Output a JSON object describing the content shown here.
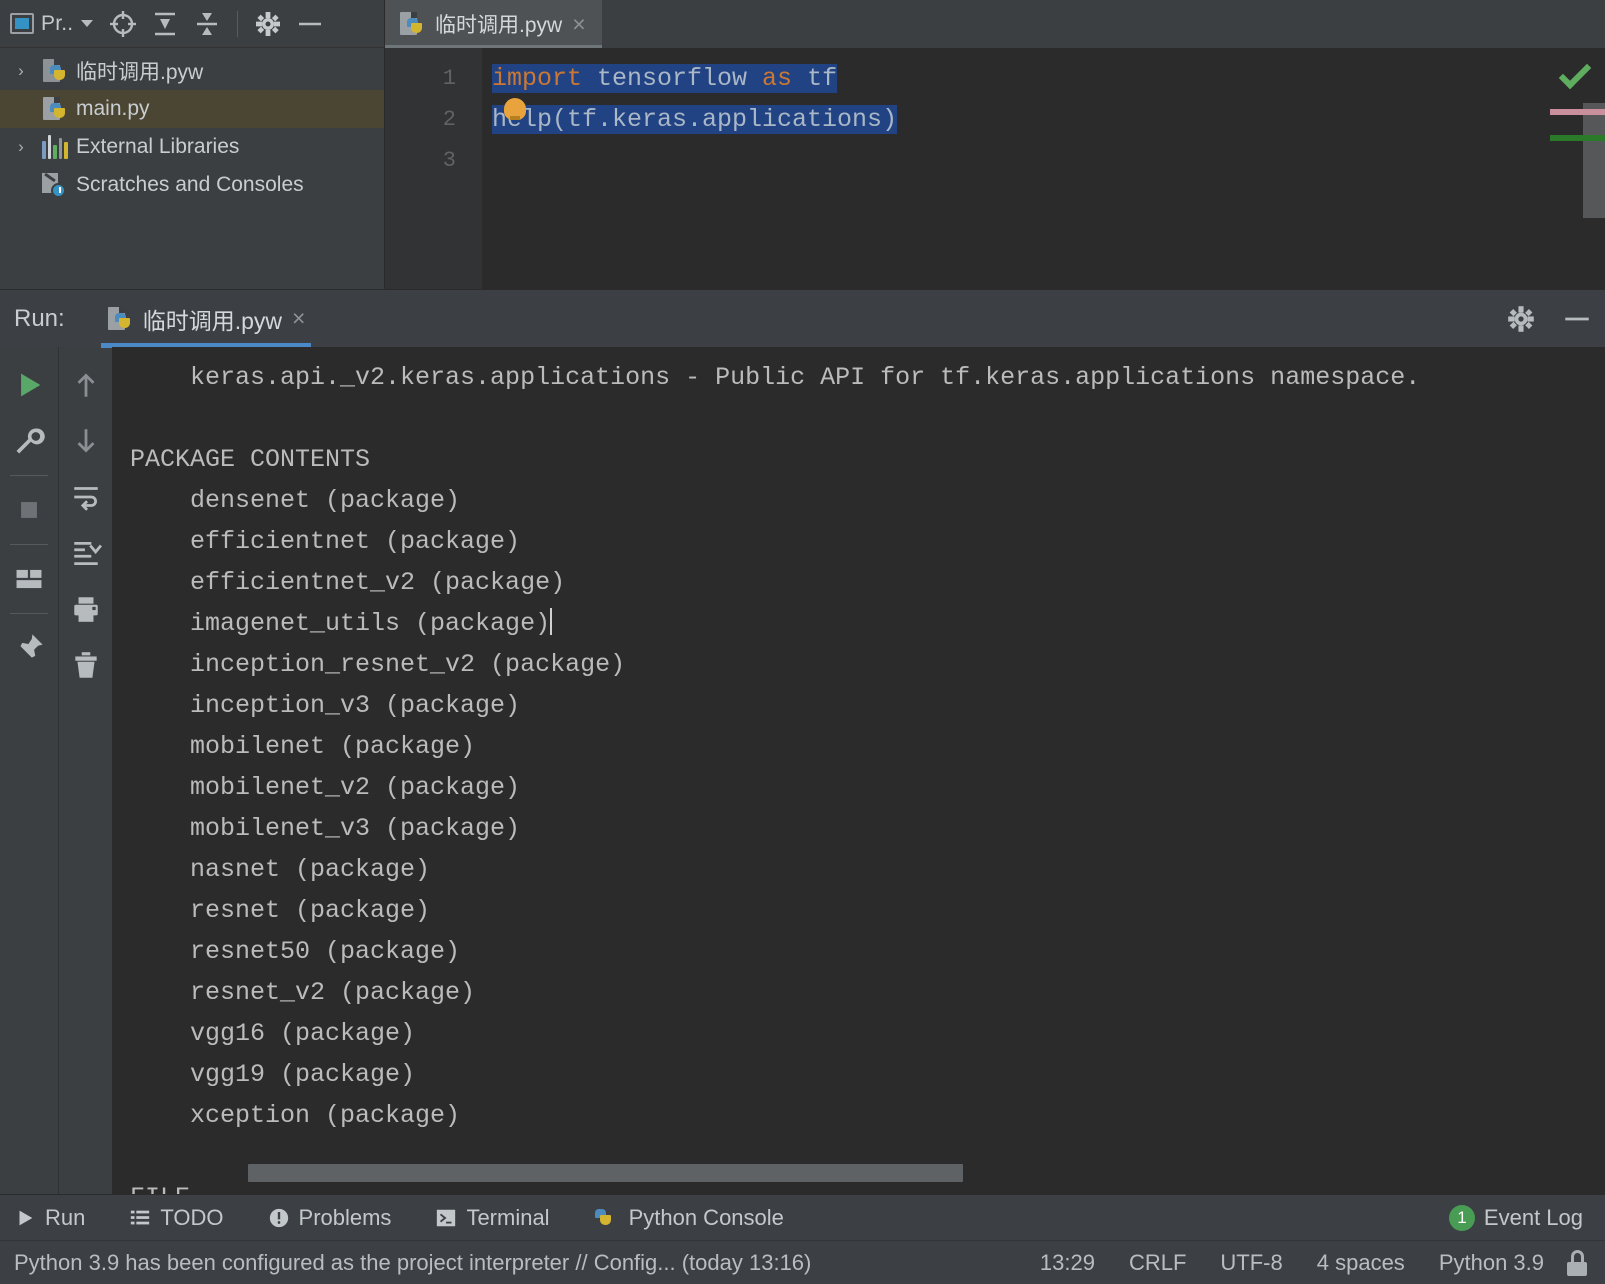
{
  "project_panel": {
    "title": "Pr..",
    "title_icon": "project-window-icon",
    "header_icons": [
      "locate-icon",
      "expand-all-icon",
      "collapse-all-icon",
      "gear-icon",
      "minimize-icon"
    ],
    "tree": [
      {
        "arrow": "›",
        "icon": "python-folder-icon",
        "label": "临时调用.pyw",
        "selected": false
      },
      {
        "arrow": "",
        "icon": "python-file-icon",
        "label": "main.py",
        "selected": true
      },
      {
        "arrow": "›",
        "icon": "external-libraries-icon",
        "label": "External Libraries",
        "selected": false
      },
      {
        "arrow": "",
        "icon": "scratches-icon",
        "label": "Scratches and Consoles",
        "selected": false
      }
    ]
  },
  "editor": {
    "tab": {
      "label": "临时调用.pyw",
      "close": "×",
      "icon": "python-file-icon"
    },
    "line_numbers": [
      "1",
      "2",
      "3"
    ],
    "lines": [
      {
        "segments": [
          {
            "t": "import",
            "c": "kw"
          },
          {
            "t": " tensorflow ",
            "c": "txt"
          },
          {
            "t": "as",
            "c": "kw"
          },
          {
            "t": " tf",
            "c": "txt"
          }
        ],
        "selected": true
      },
      {
        "segments": [
          {
            "t": "help(tf.keras.applications)",
            "c": "txt"
          }
        ],
        "selected": true
      },
      {
        "segments": [],
        "selected": false
      }
    ],
    "inspection_status": "check-ok",
    "markers": [
      "warning-marker",
      "info-marker"
    ]
  },
  "run_window": {
    "label": "Run:",
    "tab": {
      "label": "临时调用.pyw",
      "close": "×",
      "icon": "python-file-icon"
    },
    "header_icons": [
      "gear-icon",
      "minimize-icon"
    ],
    "toolbar_left": [
      "rerun-icon",
      "wrench-icon",
      "stop-icon",
      "layout-icon",
      "pin-icon"
    ],
    "toolbar_right": [
      "up-arrow-icon",
      "down-arrow-icon",
      "soft-wrap-icon",
      "scroll-to-end-icon",
      "print-icon",
      "trash-icon"
    ],
    "console_lines": [
      "    keras.api._v2.keras.applications - Public API for tf.keras.applications namespace.",
      "",
      "PACKAGE CONTENTS",
      "    densenet (package)",
      "    efficientnet (package)",
      "    efficientnet_v2 (package)",
      "    imagenet_utils (package)",
      "    inception_resnet_v2 (package)",
      "    inception_v3 (package)",
      "    mobilenet (package)",
      "    mobilenet_v2 (package)",
      "    mobilenet_v3 (package)",
      "    nasnet (package)",
      "    resnet (package)",
      "    resnet50 (package)",
      "    resnet_v2 (package)",
      "    vgg16 (package)",
      "    vgg19 (package)",
      "    xception (package)",
      "",
      "FILE"
    ],
    "caret_line_index": 6
  },
  "toolwindow_bar": {
    "items": [
      {
        "icon": "run-icon",
        "label": "Run"
      },
      {
        "icon": "todo-icon",
        "label": "TODO"
      },
      {
        "icon": "problems-icon",
        "label": "Problems"
      },
      {
        "icon": "terminal-icon",
        "label": "Terminal"
      },
      {
        "icon": "python-console-icon",
        "label": "Python Console"
      }
    ],
    "event_log": {
      "badge": "1",
      "label": "Event Log"
    }
  },
  "status_bar": {
    "message": "Python 3.9 has been configured as the project interpreter // Config... (today 13:16)",
    "items": [
      "13:29",
      "CRLF",
      "UTF-8",
      "4 spaces",
      "Python 3.9"
    ],
    "lock_icon": "unlocked-icon"
  },
  "colors": {
    "accent": "#4a88c7",
    "selection": "#214283",
    "keyword": "#cc7832",
    "text": "#a9b7c6",
    "ok": "#499c54"
  }
}
